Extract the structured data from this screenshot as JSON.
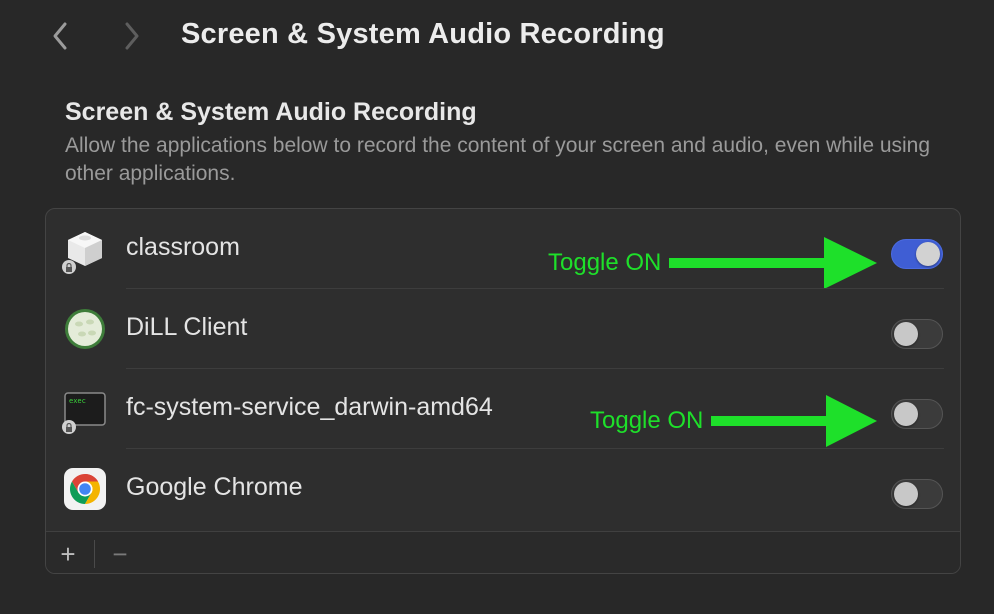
{
  "header": {
    "title": "Screen & System Audio Recording",
    "back_icon": "chevron-left-icon",
    "forward_icon": "chevron-right-icon"
  },
  "section": {
    "title": "Screen & System Audio Recording",
    "description": "Allow the applications below to record the content of your screen and audio, even while using other applications."
  },
  "apps": [
    {
      "name": "classroom",
      "icon": "classroom-app-icon",
      "enabled": true
    },
    {
      "name": "DiLL Client",
      "icon": "dill-client-app-icon",
      "enabled": false
    },
    {
      "name": "fc-system-service_darwin-amd64",
      "icon": "terminal-exec-icon",
      "enabled": false,
      "icon_text": "exec"
    },
    {
      "name": "Google Chrome",
      "icon": "chrome-icon",
      "enabled": false
    }
  ],
  "footer": {
    "add_label": "+",
    "remove_label": "−"
  },
  "annotations": [
    {
      "label": "Toggle ON",
      "color": "#1ee02a"
    },
    {
      "label": "Toggle ON",
      "color": "#1ee02a"
    }
  ],
  "colors": {
    "toggle_on": "#3f5ed4",
    "annotation": "#1ee02a",
    "background": "#282828"
  }
}
